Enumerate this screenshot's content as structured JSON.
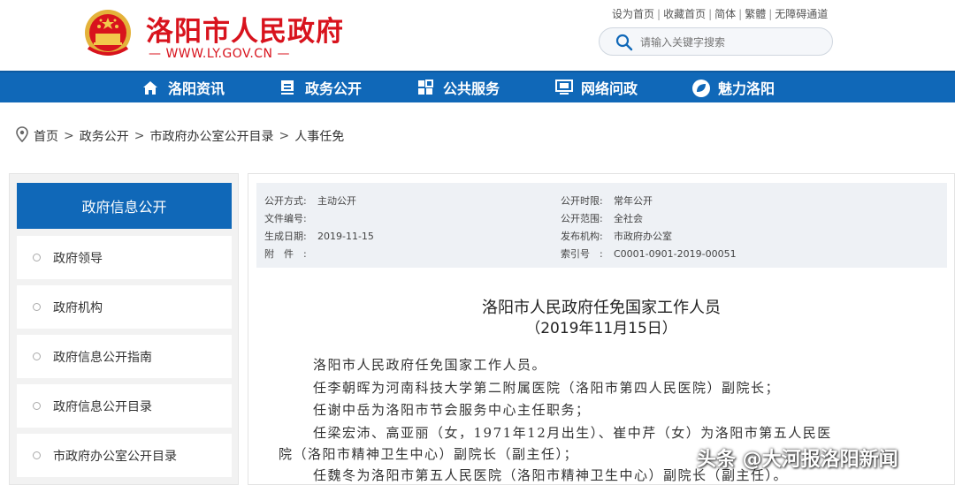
{
  "header": {
    "site_title": "洛阳市人民政府",
    "site_url": "— WWW.LY.GOV.CN —",
    "toplinks": [
      "设为首页",
      "收藏首页",
      "简体",
      "繁體",
      "无障碍通道"
    ],
    "search_placeholder": "请输入关键字搜索"
  },
  "nav": [
    {
      "label": "洛阳资讯",
      "icon": "home-icon"
    },
    {
      "label": "政务公开",
      "icon": "document-icon"
    },
    {
      "label": "公共服务",
      "icon": "grid-icon"
    },
    {
      "label": "网络问政",
      "icon": "monitor-icon"
    },
    {
      "label": "魅力洛阳",
      "icon": "leaf-icon"
    }
  ],
  "breadcrumb": [
    "首页",
    "政务公开",
    "市政府办公室公开目录",
    "人事任免"
  ],
  "sidebar": {
    "title": "政府信息公开",
    "items": [
      "政府领导",
      "政府机构",
      "政府信息公开指南",
      "政府信息公开目录",
      "市政府办公室公开目录"
    ]
  },
  "meta": {
    "left": [
      {
        "key": "公开方式:",
        "value": "主动公开"
      },
      {
        "key": "文件编号:",
        "value": ""
      },
      {
        "key": "生成日期:",
        "value": "2019-11-15"
      },
      {
        "key": "附　件　:",
        "value": ""
      }
    ],
    "right": [
      {
        "key": "公开时限:",
        "value": "常年公开"
      },
      {
        "key": "公开范围:",
        "value": "全社会"
      },
      {
        "key": "发布机构:",
        "value": "市政府办公室"
      },
      {
        "key": "索引号　:",
        "value": "C0001-0901-2019-00051"
      }
    ]
  },
  "document": {
    "title": "洛阳市人民政府任免国家工作人员",
    "date": "（2019年11月15日）",
    "paragraphs": [
      "洛阳市人民政府任免国家工作人员。",
      "任李朝晖为河南科技大学第二附属医院（洛阳市第四人民医院）副院长；",
      "任谢中岳为洛阳市节会服务中心主任职务；",
      "任梁宏沛、高亚丽（女，1971年12月出生）、崔中芹（女）为洛阳市第五人民医",
      "院（洛阳市精神卫生中心）副院长（副主任）；",
      "任魏冬为洛阳市第五人民医院（洛阳市精神卫生中心）副院长（副主任）。"
    ]
  },
  "watermark": "头条 @大河报洛阳新闻",
  "colors": {
    "brand_red": "#d8131d",
    "nav_blue": "#1068b8"
  }
}
